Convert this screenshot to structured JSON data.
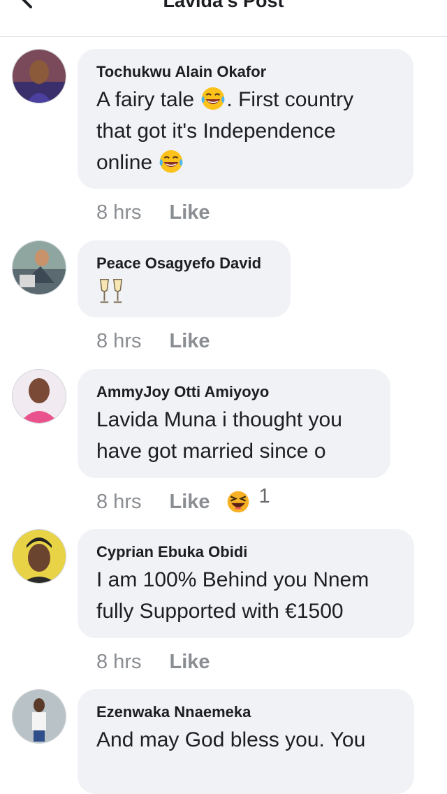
{
  "header": {
    "title": "Lavida's Post"
  },
  "comments": [
    {
      "author": "Tochukwu Alain Okafor",
      "lines": [
        "A fairy tale",
        ".  First country",
        "that got it's Independence",
        "online"
      ],
      "time": "8 hrs",
      "like": "Like"
    },
    {
      "author": "Peace Osagyefo David",
      "time": "8 hrs",
      "like": "Like"
    },
    {
      "author": "AmmyJoy Otti Amiyoyo",
      "lines": [
        "Lavida Muna i thought you",
        "have got married since o"
      ],
      "time": "8 hrs",
      "like": "Like",
      "reaction_count": "1"
    },
    {
      "author": "Cyprian Ebuka Obidi",
      "lines": [
        "I am 100% Behind you Nnem",
        "fully Supported with €1500"
      ],
      "time": "8 hrs",
      "like": "Like"
    },
    {
      "author": "Ezenwaka Nnaemeka",
      "lines": [
        "And may God bless you. You"
      ]
    }
  ],
  "icons": {
    "back": "arrow-left-icon",
    "laughing": "tears-of-joy-emoji",
    "toast": "clinking-glasses-emoji",
    "haha_reaction": "haha-reaction-icon"
  },
  "colors": {
    "bubble": "#f0f2f5",
    "meta": "#8a8d91",
    "reaction": "#f7b125"
  }
}
